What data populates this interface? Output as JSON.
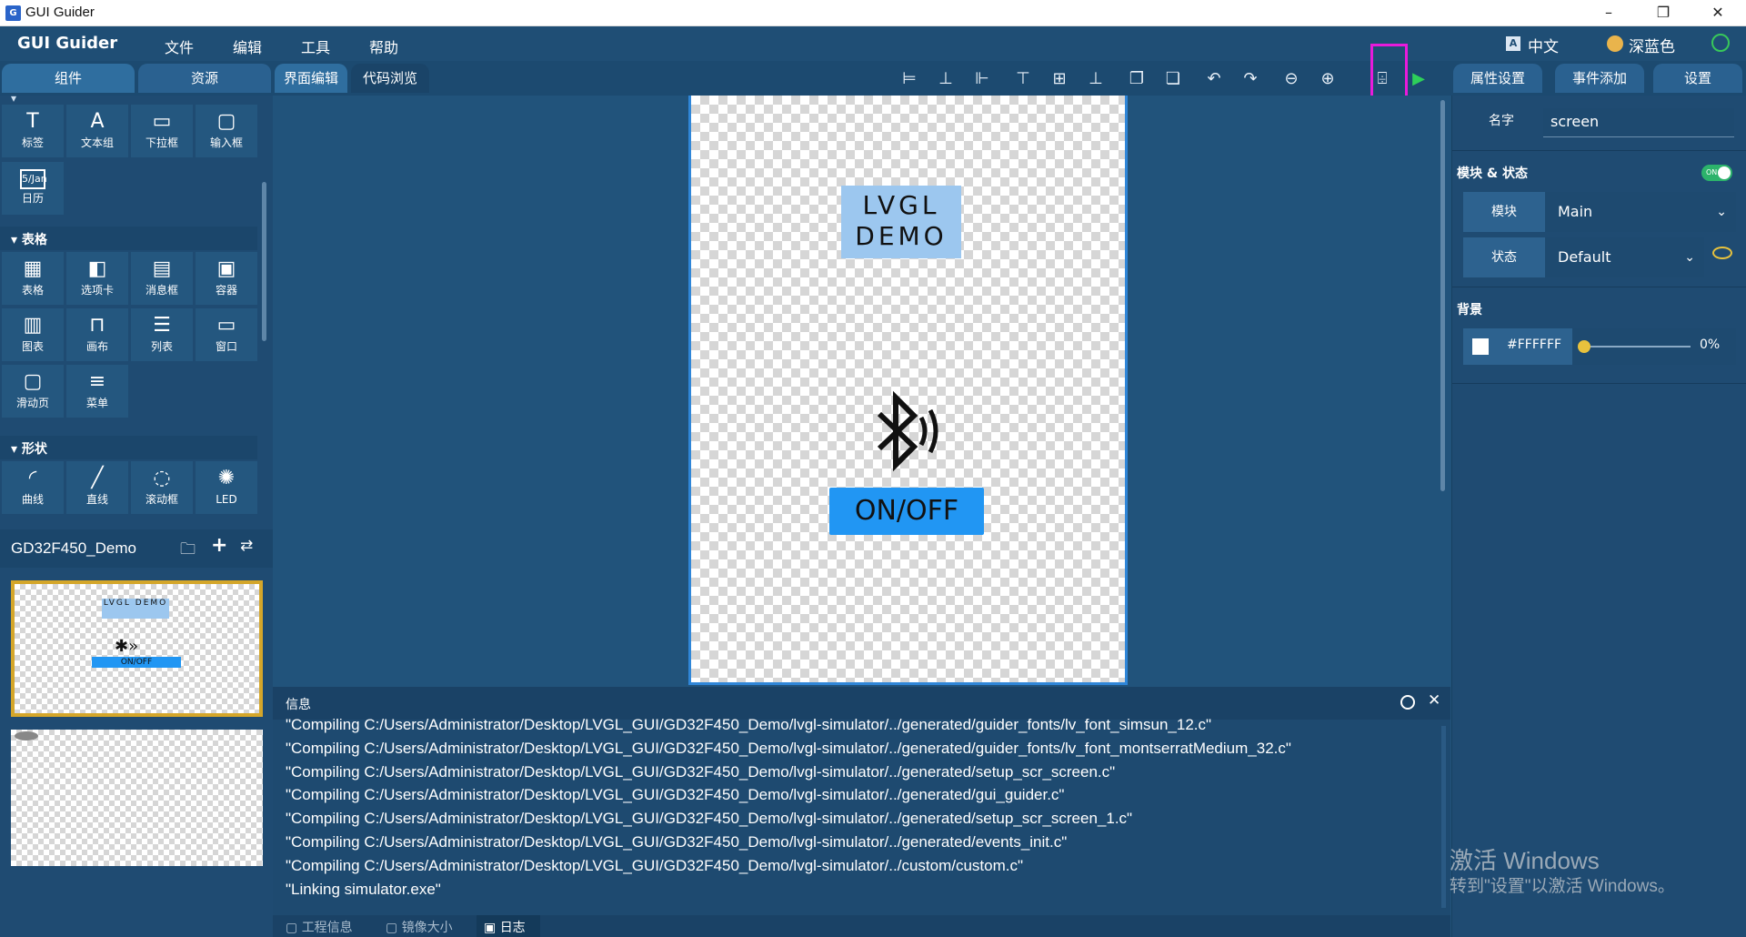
{
  "window": {
    "title": "GUI Guider",
    "app_icon_glyph": "G",
    "minimize": "–",
    "restore": "❐",
    "close": "✕"
  },
  "menubar": {
    "brand": "GUI Guider",
    "items": [
      "文件",
      "编辑",
      "工具",
      "帮助"
    ],
    "language": "中文",
    "theme": "深蓝色"
  },
  "tabs": {
    "left": [
      "组件",
      "资源"
    ],
    "center": [
      "界面编辑",
      "代码浏览"
    ],
    "right": [
      "属性设置",
      "事件添加",
      "设置"
    ]
  },
  "toolbar": {
    "icons": [
      "align-left-icon",
      "align-center-icon",
      "align-right-icon",
      "align-top-icon",
      "align-middle-icon",
      "align-bottom-icon",
      "bring-forward-icon",
      "send-backward-icon",
      "undo-icon",
      "redo-icon",
      "zoom-out-icon",
      "zoom-in-icon",
      "generate-code-icon",
      "run-simulator-icon"
    ],
    "glyphs": [
      "⊨",
      "⊥",
      "⊩",
      "⊤",
      "⊞",
      "⊥",
      "❐",
      "❏",
      "↶",
      "↷",
      "⊖",
      "⊕",
      "⌹",
      "▶"
    ]
  },
  "palette": {
    "top_widgets": [
      {
        "label": "标签",
        "icon": "T"
      },
      {
        "label": "文本组",
        "icon": "A"
      },
      {
        "label": "下拉框",
        "icon": "▭"
      },
      {
        "label": "输入框",
        "icon": "▢"
      }
    ],
    "calendar": {
      "label": "日历",
      "icon": "5/Jan"
    },
    "sections": [
      {
        "title": "表格",
        "items": [
          {
            "label": "表格",
            "icon": "▦"
          },
          {
            "label": "选项卡",
            "icon": "◧"
          },
          {
            "label": "消息框",
            "icon": "▤"
          },
          {
            "label": "容器",
            "icon": "▣"
          },
          {
            "label": "图表",
            "icon": "▥"
          },
          {
            "label": "画布",
            "icon": "⊓"
          },
          {
            "label": "列表",
            "icon": "☰"
          },
          {
            "label": "窗口",
            "icon": "▭"
          },
          {
            "label": "滑动页",
            "icon": "▢"
          },
          {
            "label": "菜单",
            "icon": "≡"
          }
        ]
      },
      {
        "title": "形状",
        "items": [
          {
            "label": "曲线",
            "icon": "◜"
          },
          {
            "label": "直线",
            "icon": "╱"
          },
          {
            "label": "滚动框",
            "icon": "◌"
          },
          {
            "label": "LED",
            "icon": "✺"
          }
        ]
      }
    ]
  },
  "project": {
    "name": "GD32F450_Demo",
    "icons": [
      "folder-icon",
      "add-icon",
      "refresh-icon"
    ],
    "glyphs": [
      "🗀",
      "+",
      "⇄"
    ]
  },
  "canvas": {
    "title_line1": "LVGL",
    "title_line2": "DEMO",
    "button_label": "ON/OFF",
    "thumb_title": "LVGL DEMO",
    "thumb_button": "ON/OFF"
  },
  "properties": {
    "name_label": "名字",
    "name_value": "screen",
    "module_state_title": "模块 & 状态",
    "toggle_text": "ON",
    "module_label": "模块",
    "module_value": "Main",
    "state_label": "状态",
    "state_value": "Default",
    "background_title": "背景",
    "bg_color": "#FFFFFF",
    "bg_opacity": "0%"
  },
  "info": {
    "title": "信息",
    "lines": [
      "\"Compiling C:/Users/Administrator/Desktop/LVGL_GUI/GD32F450_Demo/lvgl-simulator/../generated/guider_fonts/lv_font_simsun_12.c\"",
      "\"Compiling C:/Users/Administrator/Desktop/LVGL_GUI/GD32F450_Demo/lvgl-simulator/../generated/guider_fonts/lv_font_montserratMedium_32.c\"",
      "\"Compiling C:/Users/Administrator/Desktop/LVGL_GUI/GD32F450_Demo/lvgl-simulator/../generated/setup_scr_screen.c\"",
      "\"Compiling C:/Users/Administrator/Desktop/LVGL_GUI/GD32F450_Demo/lvgl-simulator/../generated/gui_guider.c\"",
      "\"Compiling C:/Users/Administrator/Desktop/LVGL_GUI/GD32F450_Demo/lvgl-simulator/../generated/setup_scr_screen_1.c\"",
      "\"Compiling C:/Users/Administrator/Desktop/LVGL_GUI/GD32F450_Demo/lvgl-simulator/../generated/events_init.c\"",
      "\"Compiling C:/Users/Administrator/Desktop/LVGL_GUI/GD32F450_Demo/lvgl-simulator/../custom/custom.c\"",
      "\"Linking simulator.exe\""
    ],
    "bottom_tabs": [
      "工程信息",
      "镜像大小",
      "日志"
    ]
  },
  "watermark": {
    "line1": "激活 Windows",
    "line2": "转到\"设置\"以激活 Windows。"
  },
  "colors": {
    "accent": "#2196f3",
    "highlight": "#e81bdb",
    "panel": "#1f4b72",
    "selected_thumb_border": "#d4a62a"
  }
}
